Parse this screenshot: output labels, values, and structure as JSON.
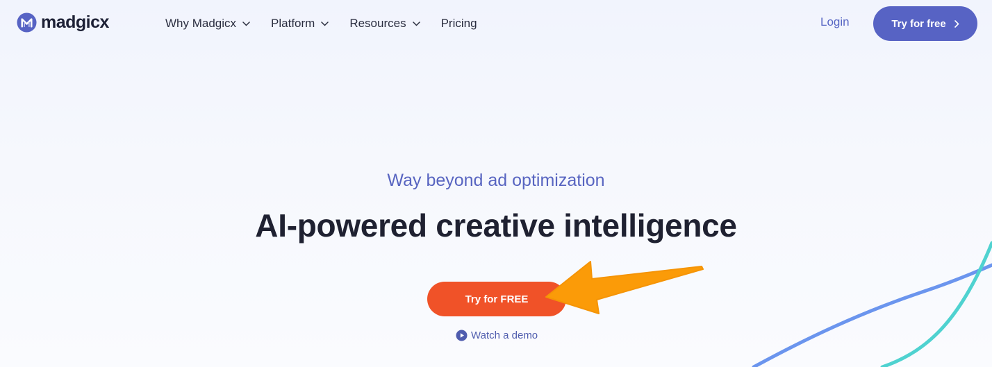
{
  "brand": {
    "name": "madgicx"
  },
  "nav": {
    "items": [
      {
        "label": "Why Madgicx",
        "has_dropdown": true
      },
      {
        "label": "Platform",
        "has_dropdown": true
      },
      {
        "label": "Resources",
        "has_dropdown": true
      },
      {
        "label": "Pricing",
        "has_dropdown": false
      }
    ],
    "login_label": "Login",
    "cta_label": "Try for free"
  },
  "hero": {
    "subtitle": "Way beyond ad optimization",
    "headline": "AI-powered creative intelligence",
    "cta_label": "Try for FREE",
    "demo_label": "Watch a demo"
  },
  "colors": {
    "brand_purple": "#5763c4",
    "cta_orange": "#f05228",
    "annotation_arrow": "#fb9b08",
    "deco_blue_line": "#6b95ee",
    "deco_teal_line": "#4fd2d0"
  },
  "icons": {
    "logo": "madgicx-logo-icon",
    "dropdown": "chevron-down-icon",
    "cta_arrow": "chevron-right-icon",
    "demo": "play-circle-icon",
    "annotation": "orange-pointer-arrow"
  }
}
